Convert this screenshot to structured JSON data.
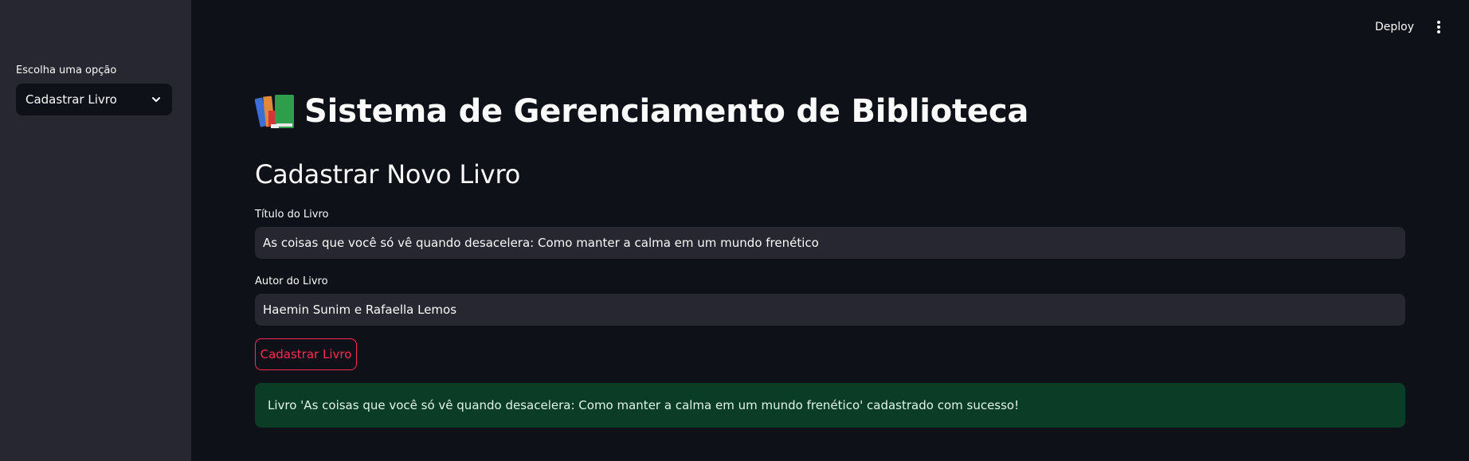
{
  "sidebar": {
    "select_label": "Escolha uma opção",
    "select_value": "Cadastrar Livro"
  },
  "header": {
    "deploy_label": "Deploy",
    "menu_icon": "kebab-menu-icon"
  },
  "main": {
    "title": "Sistema de Gerenciamento de Biblioteca",
    "title_icon": "books-icon",
    "subtitle": "Cadastrar Novo Livro",
    "title_field": {
      "label": "Título do Livro",
      "value": "As coisas que você só vê quando desacelera: Como manter a calma em um mundo frenético"
    },
    "author_field": {
      "label": "Autor do Livro",
      "value": "Haemin Sunim e Rafaella Lemos"
    },
    "submit_label": "Cadastrar Livro",
    "success_message": "Livro 'As coisas que você só vê quando desacelera: Como manter a calma em um mundo frenético' cadastrado com sucesso!"
  },
  "colors": {
    "background": "#0e1117",
    "sidebar": "#262730",
    "input": "#262730",
    "accent": "#ff2b55",
    "success_bg": "#0b3d26"
  }
}
